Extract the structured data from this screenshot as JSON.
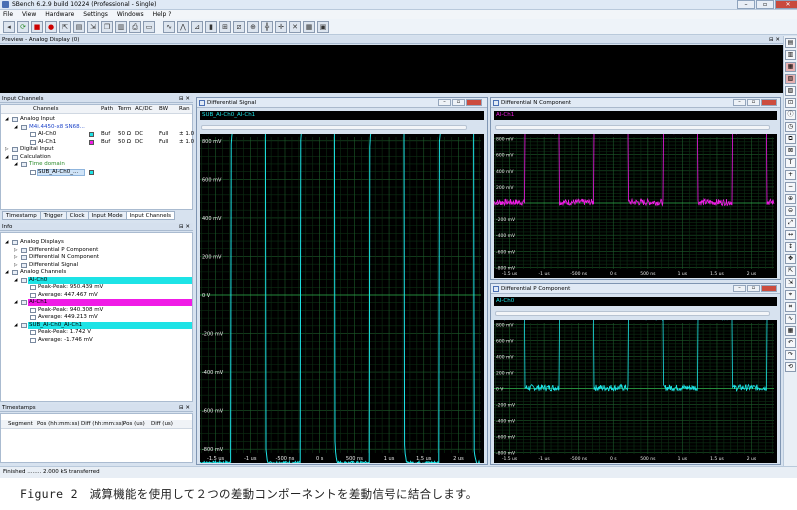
{
  "app": {
    "title": "SBench 6.2.9 build 10224 (Professional - Single)",
    "controls": [
      "–",
      "▫",
      "✕"
    ]
  },
  "menu": [
    "File",
    "View",
    "Hardware",
    "Settings",
    "Windows",
    "Help ?"
  ],
  "preview": {
    "title": "Preview - Analog Display (0)"
  },
  "input_channels": {
    "title": "Input Channels",
    "headers": [
      "Channels",
      "Path",
      "Term",
      "AC/DC",
      "BW",
      "Ran"
    ],
    "rows": [
      {
        "label": "Analog Input",
        "indent": 1,
        "exp": "◢"
      },
      {
        "label": "M4i.4450-x8 SN68...",
        "indent": 2,
        "exp": "◢",
        "color": "#1d44c8"
      },
      {
        "label": "AI-Ch0",
        "indent": 3,
        "chip": "#1de3e6",
        "path": "Buf",
        "term": "50 Ω",
        "acdc": "DC",
        "bw": "Full",
        "ran": "± 1.0"
      },
      {
        "label": "AI-Ch1",
        "indent": 3,
        "chip": "#f01be6",
        "path": "Buf",
        "term": "50 Ω",
        "acdc": "DC",
        "bw": "Full",
        "ran": "± 1.0"
      },
      {
        "label": "Digital Input",
        "indent": 1,
        "exp": "▷"
      },
      {
        "label": "Calculation",
        "indent": 1,
        "exp": "◢"
      },
      {
        "label": "Time domain",
        "indent": 2,
        "exp": "◢",
        "color": "#2a8a2a"
      },
      {
        "label": "SUB_AI-Ch0_...",
        "indent": 3,
        "chip": "#1de3e6",
        "sel": true
      }
    ],
    "tabs": [
      "Timestamp",
      "Trigger",
      "Clock",
      "Input Mode",
      "Input Channels"
    ]
  },
  "info": {
    "title": "Info",
    "rows": [
      {
        "label": "Analog Displays",
        "indent": 1,
        "exp": "◢"
      },
      {
        "label": "Differential P Component",
        "indent": 2,
        "exp": "▷"
      },
      {
        "label": "Differential N Component",
        "indent": 2,
        "exp": "▷"
      },
      {
        "label": "Differential Signal",
        "indent": 2,
        "exp": "▷"
      },
      {
        "label": "Analog Channels",
        "indent": 1,
        "exp": "◢"
      },
      {
        "label": "AI-Ch0",
        "indent": 2,
        "exp": "◢",
        "hl": "#1de3e6"
      },
      {
        "label": "Peak-Peak:  950.439 mV",
        "indent": 3
      },
      {
        "label": "Average:  447.467 mV",
        "indent": 3
      },
      {
        "label": "AI-Ch1",
        "indent": 2,
        "exp": "◢",
        "hl": "#f01be6"
      },
      {
        "label": "Peak-Peak:  940.308 mV",
        "indent": 3
      },
      {
        "label": "Average:  449.213 mV",
        "indent": 3
      },
      {
        "label": "SUB_AI-Ch0_AI-Ch1",
        "indent": 2,
        "exp": "◢",
        "hl": "#1de3e6"
      },
      {
        "label": "Peak-Peak:  1.742 V",
        "indent": 3
      },
      {
        "label": "Average:  -1.746 mV",
        "indent": 3
      }
    ]
  },
  "timestamps": {
    "title": "Timestamps",
    "headers": [
      "Segment",
      "Pos (hh:mm:ss)",
      "Diff (hh:mm:ss)",
      "Pos (us)",
      "Diff (us)"
    ]
  },
  "status": "Finished ........ 2.000 kS transferred",
  "displays": {
    "signal": {
      "title": "Differential Signal",
      "channel": "SUB_AI-Ch0_AI-Ch1",
      "color": "#1de3e6",
      "yticks": [
        "800 mV",
        "600 mV",
        "400 mV",
        "200 mV",
        "0 V",
        "-200 mV",
        "-400 mV",
        "-600 mV",
        "-800 mV"
      ],
      "xticks": [
        "-1.5 us",
        "-1 us",
        "-500 ns",
        "0 s",
        "500 ns",
        "1 us",
        "1.5 us",
        "2 us"
      ]
    },
    "n": {
      "title": "Differential N Component",
      "channel": "AI-Ch1",
      "color": "#f01be6",
      "yticks": [
        "800 mV",
        "600 mV",
        "400 mV",
        "200 mV",
        "0 V",
        "-200 mV",
        "-400 mV",
        "-600 mV",
        "-800 mV"
      ],
      "xticks": [
        "-1.5 us",
        "-1 us",
        "-500 ns",
        "0 s",
        "500 ns",
        "1 us",
        "1.5 us",
        "2 us"
      ]
    },
    "p": {
      "title": "Differential P Component",
      "channel": "AI-Ch0",
      "color": "#1de3e6",
      "yticks": [
        "800 mV",
        "600 mV",
        "400 mV",
        "200 mV",
        "0 V",
        "-200 mV",
        "-400 mV",
        "-600 mV",
        "-800 mV"
      ],
      "xticks": [
        "-1.5 us",
        "-1 us",
        "-500 ns",
        "0 s",
        "500 ns",
        "1 us",
        "1.5 us",
        "2 us"
      ]
    }
  },
  "caption": "Figure 2　減算機能を使用して２つの差動コンポーネントを差動信号に結合します。"
}
